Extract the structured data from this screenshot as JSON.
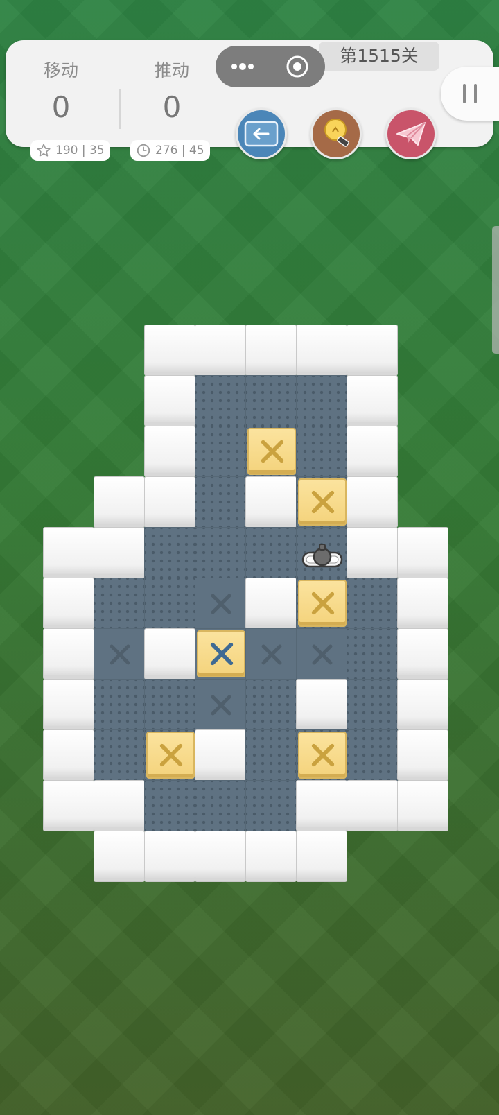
{
  "stats": {
    "moves_label": "移动",
    "moves_value": "0",
    "pushes_label": "推动",
    "pushes_value": "0",
    "star_record": "190 | 35",
    "time_record": "276 | 45"
  },
  "level": {
    "label": "第1515关"
  },
  "icons": {
    "more": "more-dots-icon",
    "close": "target-circle-icon",
    "undo": "undo-arrow-icon",
    "hint": "lightbulb-icon",
    "share": "paper-plane-icon",
    "pause": "pause-icon",
    "star": "star-icon",
    "clock": "clock-icon"
  },
  "colors": {
    "undo_button": "#4b86b8",
    "hint_button": "#a56a47",
    "share_button": "#c9546a",
    "box": "#f4d37c",
    "floor": "#5f7282",
    "wall": "#f1f1f1"
  },
  "board": {
    "columns": 8,
    "rows": 11,
    "legend": {
      "#": "wall",
      "_": "floor",
      ".": "target",
      "$": "box",
      "*": "box-on-target",
      "@": "player",
      "-": "empty"
    },
    "rows_data": [
      "--#####-",
      "--#___#-",
      "--#_$_#-",
      "-##_#$#-",
      "##___@##",
      "#__.#$_#",
      "#.#*.._#",
      "#__.__#_#",
      "#_$#_$_#",
      "##___###",
      "-#####--"
    ]
  }
}
